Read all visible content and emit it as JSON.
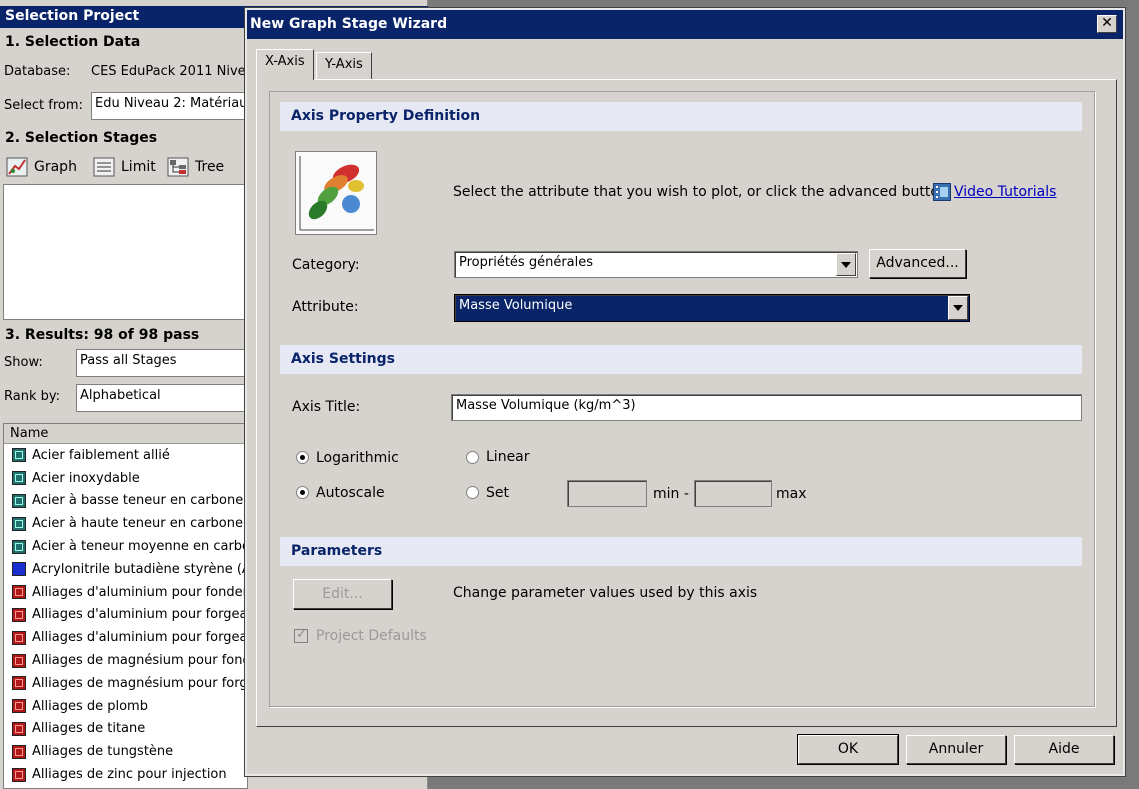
{
  "left_panel": {
    "title": "Selection Project",
    "section1_heading": "1. Selection Data",
    "database_label": "Database:",
    "database_value": "CES EduPack 2011 Nive",
    "select_from_label": "Select from:",
    "select_from_value": "Edu Niveau 2: Matériau",
    "section2_heading": "2. Selection Stages",
    "stage_buttons": {
      "graph": "Graph",
      "limit": "Limit",
      "tree": "Tree"
    },
    "section3_heading": "3. Results: 98 of 98 pass",
    "show_label": "Show:",
    "show_value": "Pass all Stages",
    "rank_label": "Rank by:",
    "rank_value": "Alphabetical",
    "results_header": "Name",
    "results": [
      {
        "name": "Acier faiblement allié",
        "color": "teal"
      },
      {
        "name": "Acier inoxydable",
        "color": "teal"
      },
      {
        "name": "Acier à basse teneur en carbone",
        "color": "teal"
      },
      {
        "name": "Acier à haute teneur en carbone",
        "color": "teal"
      },
      {
        "name": "Acier à teneur moyenne en carbo",
        "color": "teal"
      },
      {
        "name": "Acrylonitrile butadiène styrène (A",
        "color": "blue"
      },
      {
        "name": "Alliages d'aluminium pour fonderie",
        "color": "red"
      },
      {
        "name": "Alliages d'aluminium pour forgeag",
        "color": "red"
      },
      {
        "name": "Alliages d'aluminium pour forgeag",
        "color": "red"
      },
      {
        "name": "Alliages de magnésium pour fond",
        "color": "red"
      },
      {
        "name": "Alliages de magnésium pour forge",
        "color": "red"
      },
      {
        "name": "Alliages de plomb",
        "color": "red"
      },
      {
        "name": "Alliages de titane",
        "color": "red"
      },
      {
        "name": "Alliages de tungstène",
        "color": "red"
      },
      {
        "name": "Alliages de zinc pour injection",
        "color": "red"
      }
    ]
  },
  "dialog": {
    "title": "New Graph Stage Wizard",
    "close_label": "✕",
    "tabs": [
      "X-Axis",
      "Y-Axis"
    ],
    "axis_property_heading": "Axis Property Definition",
    "instruction": "Select the attribute that you wish to plot, or click the advanced button",
    "video_tutorials": "Video Tutorials",
    "category_label": "Category:",
    "category_value": "Propriétés générales",
    "advanced_button": "Advanced...",
    "attribute_label": "Attribute:",
    "attribute_value": "Masse Volumique",
    "axis_settings_heading": "Axis Settings",
    "axis_title_label": "Axis Title:",
    "axis_title_value": "Masse Volumique (kg/m^3)",
    "scale_options": {
      "logarithmic": "Logarithmic",
      "linear": "Linear",
      "selected": "logarithmic"
    },
    "range_options": {
      "autoscale": "Autoscale",
      "set": "Set",
      "selected": "autoscale"
    },
    "min_label": "min -",
    "max_label": "max",
    "min_value": "",
    "max_value": "",
    "parameters_heading": "Parameters",
    "edit_button": "Edit...",
    "parameters_text": "Change parameter values used by this axis",
    "project_defaults_label": "Project Defaults",
    "project_defaults_checked": true,
    "ok_button": "OK",
    "cancel_button": "Annuler",
    "help_button": "Aide"
  },
  "colors": {
    "titlebar": "#0a246a",
    "section_bar": "#e6e8f4",
    "window_bg": "#d6d3ce",
    "selection": "#0a246a"
  }
}
